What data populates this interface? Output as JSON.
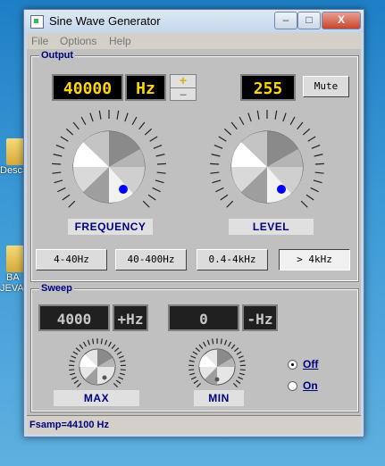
{
  "desktop": {
    "icons": [
      {
        "label": "Desca"
      },
      {
        "label": "BA"
      },
      {
        "label": "JEVA"
      }
    ]
  },
  "window": {
    "title": "Sine Wave Generator",
    "controls": {
      "minimize": "–",
      "maximize": "□",
      "close": "X"
    }
  },
  "menu": [
    "File",
    "Options",
    "Help"
  ],
  "output": {
    "title": "Output",
    "frequency_value": "40000",
    "frequency_unit": "Hz",
    "plus": "+",
    "minus": "–",
    "level_value": "255",
    "mute_label": "Mute",
    "frequency_label": "FREQUENCY",
    "level_label": "LEVEL",
    "ranges": [
      "4-40Hz",
      "40-400Hz",
      "0.4-4kHz",
      "> 4kHz"
    ],
    "active_range": "> 4kHz"
  },
  "sweep": {
    "title": "Sweep",
    "max_value": "4000",
    "max_unit": "+Hz",
    "min_value": "0",
    "min_unit": "-Hz",
    "max_label": "MAX",
    "min_label": "MIN",
    "off_label": "Off",
    "on_label": "On",
    "selected": "Off"
  },
  "status": {
    "text": "Fsamp=44100 Hz"
  },
  "colors": {
    "lcd_text": "#ffd700",
    "label_text": "#000080",
    "knob_dot": "#0000ff"
  }
}
